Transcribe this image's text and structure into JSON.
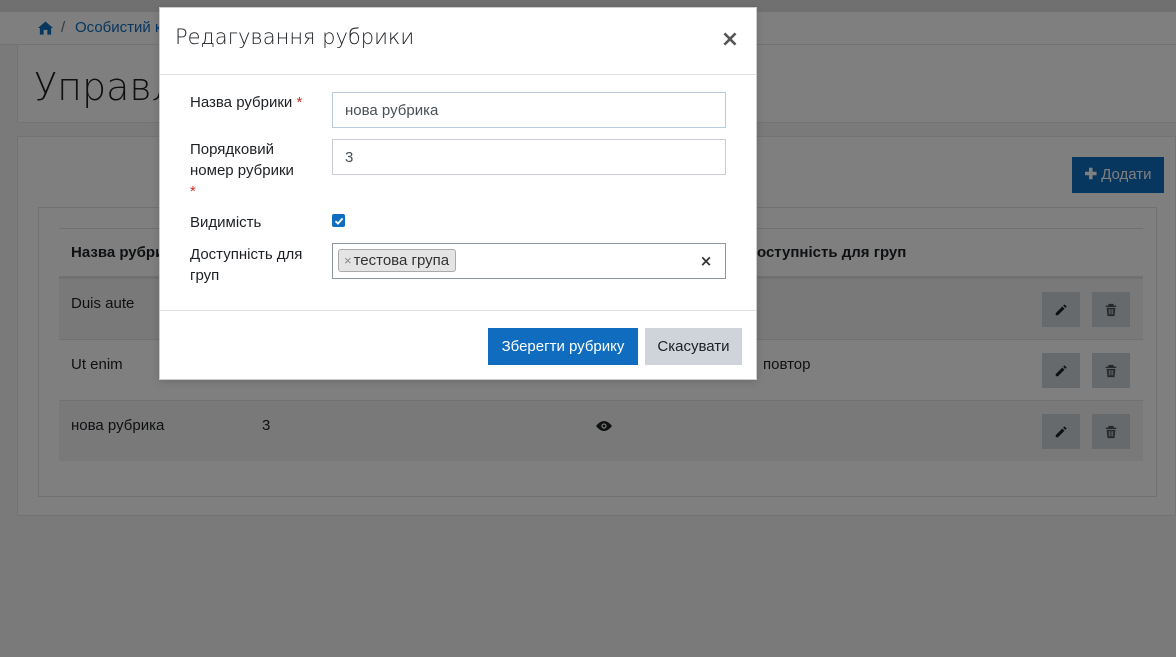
{
  "breadcrumb": {
    "home_icon": "home-icon",
    "separator": "/",
    "item": "Особистий к"
  },
  "page": {
    "title": "Управлі"
  },
  "card": {
    "add_label": "Додати",
    "add_icon": "plus-icon",
    "table": {
      "headers": [
        "Назва рубри",
        "оступність для груп"
      ],
      "rows": [
        {
          "name": "Duis aute",
          "number": "",
          "visibility_icon": "",
          "groups": ""
        },
        {
          "name": "Ut enim",
          "number": "",
          "visibility_icon": "",
          "groups": "повтор"
        },
        {
          "name": "нова рубрика",
          "number": "3",
          "visibility_icon": "eye-icon",
          "groups": ""
        }
      ]
    }
  },
  "modal": {
    "title": "Редагування рубрики",
    "close_glyph": "×",
    "fields": {
      "name_label": "Назва рубрики",
      "name_value": "нова рубрика",
      "order_label_line1": "Порядковий",
      "order_label_line2": "номер рубрики",
      "order_value": "3",
      "required_mark": "*",
      "visibility_label": "Видимість",
      "visibility_checked": true,
      "groups_label_line1": "Доступність для",
      "groups_label_line2": "груп",
      "groups_selected": [
        "тестова група"
      ],
      "tag_remove_glyph": "×",
      "clear_glyph": "×"
    },
    "footer": {
      "save_label": "Зберегти рубрику",
      "cancel_label": "Скасувати"
    }
  },
  "colors": {
    "primary": "#0f6cbf",
    "required": "#ca3120",
    "secondary_button": "#ced4da",
    "backdrop": "rgba(0,0,0,0.5)"
  }
}
